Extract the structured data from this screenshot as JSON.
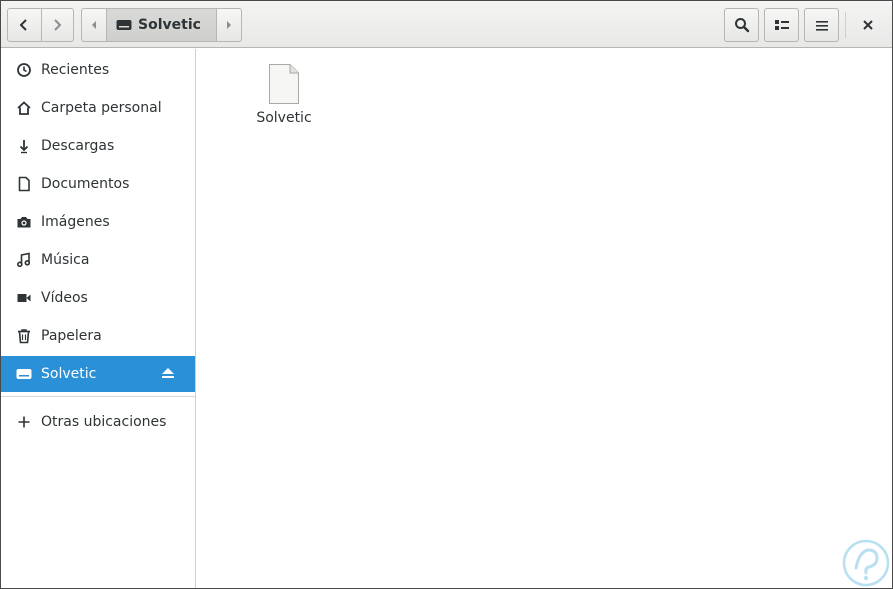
{
  "header": {
    "location": "Solvetic"
  },
  "sidebar": {
    "items": [
      {
        "label": "Recientes",
        "icon": "clock-icon"
      },
      {
        "label": "Carpeta personal",
        "icon": "home-icon"
      },
      {
        "label": "Descargas",
        "icon": "download-icon"
      },
      {
        "label": "Documentos",
        "icon": "document-icon"
      },
      {
        "label": "Imágenes",
        "icon": "camera-icon"
      },
      {
        "label": "Música",
        "icon": "music-icon"
      },
      {
        "label": "Vídeos",
        "icon": "video-icon"
      },
      {
        "label": "Papelera",
        "icon": "trash-icon"
      },
      {
        "label": "Solvetic",
        "icon": "drive-icon",
        "active": true
      },
      {
        "label": "Otras ubicaciones",
        "icon": "plus-icon"
      }
    ]
  },
  "main": {
    "files": [
      {
        "name": "Solvetic",
        "icon": "file-icon"
      }
    ]
  },
  "colors": {
    "accent": "#2a91d9",
    "text": "#2e3436"
  }
}
